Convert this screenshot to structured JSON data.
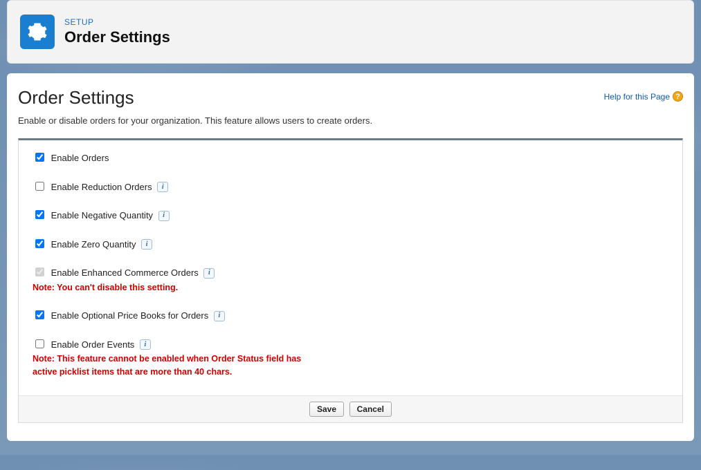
{
  "header": {
    "crumb": "SETUP",
    "title": "Order Settings"
  },
  "page": {
    "title": "Order Settings",
    "description": "Enable or disable orders for your organization. This feature allows users to create orders.",
    "help_label": "Help for this Page"
  },
  "options": {
    "enable_orders": {
      "label": "Enable Orders",
      "checked": true
    },
    "enable_reduction_orders": {
      "label": "Enable Reduction Orders",
      "checked": false
    },
    "enable_negative_quantity": {
      "label": "Enable Negative Quantity",
      "checked": true
    },
    "enable_zero_quantity": {
      "label": "Enable Zero Quantity",
      "checked": true
    },
    "enable_enhanced_commerce_orders": {
      "label": "Enable Enhanced Commerce Orders",
      "checked": true,
      "disabled": true,
      "note": "Note: You can't disable this setting."
    },
    "enable_optional_price_books": {
      "label": "Enable Optional Price Books for Orders",
      "checked": true
    },
    "enable_order_events": {
      "label": "Enable Order Events",
      "checked": false,
      "note": "Note: This feature cannot be enabled when Order Status field has active picklist items that are more than 40 chars."
    }
  },
  "buttons": {
    "save": "Save",
    "cancel": "Cancel"
  },
  "info_glyph": "i",
  "help_glyph": "?"
}
